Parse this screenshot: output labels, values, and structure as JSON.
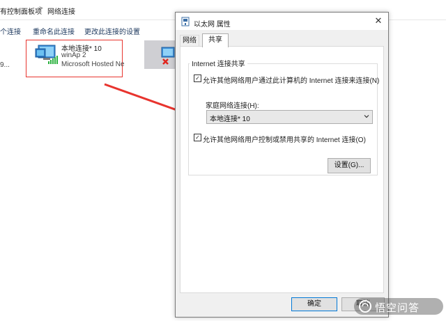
{
  "explorer": {
    "breadcrumb": [
      "有控制面板项",
      "网络连接"
    ],
    "breadcrumb_separator": ">",
    "commands": [
      "个连接",
      "重命名此连接",
      "更改此连接的设置"
    ],
    "left_stub": "9...",
    "item": {
      "name": "本地连接* 10",
      "ssid": "winAp 2",
      "adapter": "Microsoft Hosted Netwo..."
    }
  },
  "dialog": {
    "title": "以太网 属性",
    "tabs": [
      "网络",
      "共享"
    ],
    "active_tab": "共享",
    "group_title": "Internet 连接共享",
    "allow_share_label": "允许其他网络用户通过此计算机的 Internet 连接来连接(N)",
    "allow_share_checked": true,
    "home_network_label": "家庭网络连接(H):",
    "home_network_value": "本地连接* 10",
    "allow_control_label": "允许其他网络用户控制或禁用共享的 Internet 连接(O)",
    "allow_control_checked": true,
    "settings_button": "设置(G)...",
    "ok_button": "确定",
    "cancel_button": "取消"
  },
  "watermark_text": "悟空问答",
  "colors": {
    "highlight_red": "#e8342e",
    "accent_blue": "#0078d7"
  }
}
